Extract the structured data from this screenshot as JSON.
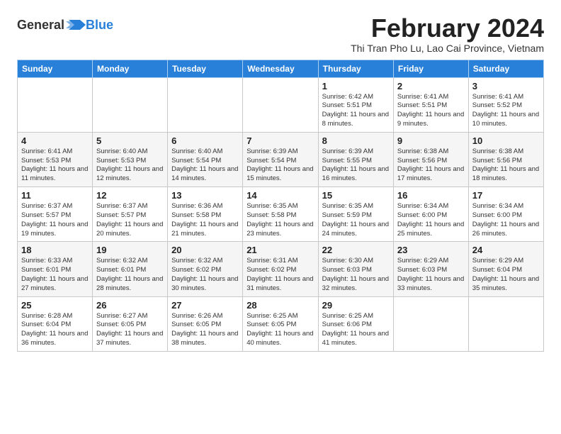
{
  "logo": {
    "general": "General",
    "blue": "Blue"
  },
  "header": {
    "month_year": "February 2024",
    "location": "Thi Tran Pho Lu, Lao Cai Province, Vietnam"
  },
  "weekdays": [
    "Sunday",
    "Monday",
    "Tuesday",
    "Wednesday",
    "Thursday",
    "Friday",
    "Saturday"
  ],
  "weeks": [
    [
      {
        "day": "",
        "info": ""
      },
      {
        "day": "",
        "info": ""
      },
      {
        "day": "",
        "info": ""
      },
      {
        "day": "",
        "info": ""
      },
      {
        "day": "1",
        "info": "Sunrise: 6:42 AM\nSunset: 5:51 PM\nDaylight: 11 hours and 8 minutes."
      },
      {
        "day": "2",
        "info": "Sunrise: 6:41 AM\nSunset: 5:51 PM\nDaylight: 11 hours and 9 minutes."
      },
      {
        "day": "3",
        "info": "Sunrise: 6:41 AM\nSunset: 5:52 PM\nDaylight: 11 hours and 10 minutes."
      }
    ],
    [
      {
        "day": "4",
        "info": "Sunrise: 6:41 AM\nSunset: 5:53 PM\nDaylight: 11 hours and 11 minutes."
      },
      {
        "day": "5",
        "info": "Sunrise: 6:40 AM\nSunset: 5:53 PM\nDaylight: 11 hours and 12 minutes."
      },
      {
        "day": "6",
        "info": "Sunrise: 6:40 AM\nSunset: 5:54 PM\nDaylight: 11 hours and 14 minutes."
      },
      {
        "day": "7",
        "info": "Sunrise: 6:39 AM\nSunset: 5:54 PM\nDaylight: 11 hours and 15 minutes."
      },
      {
        "day": "8",
        "info": "Sunrise: 6:39 AM\nSunset: 5:55 PM\nDaylight: 11 hours and 16 minutes."
      },
      {
        "day": "9",
        "info": "Sunrise: 6:38 AM\nSunset: 5:56 PM\nDaylight: 11 hours and 17 minutes."
      },
      {
        "day": "10",
        "info": "Sunrise: 6:38 AM\nSunset: 5:56 PM\nDaylight: 11 hours and 18 minutes."
      }
    ],
    [
      {
        "day": "11",
        "info": "Sunrise: 6:37 AM\nSunset: 5:57 PM\nDaylight: 11 hours and 19 minutes."
      },
      {
        "day": "12",
        "info": "Sunrise: 6:37 AM\nSunset: 5:57 PM\nDaylight: 11 hours and 20 minutes."
      },
      {
        "day": "13",
        "info": "Sunrise: 6:36 AM\nSunset: 5:58 PM\nDaylight: 11 hours and 21 minutes."
      },
      {
        "day": "14",
        "info": "Sunrise: 6:35 AM\nSunset: 5:58 PM\nDaylight: 11 hours and 23 minutes."
      },
      {
        "day": "15",
        "info": "Sunrise: 6:35 AM\nSunset: 5:59 PM\nDaylight: 11 hours and 24 minutes."
      },
      {
        "day": "16",
        "info": "Sunrise: 6:34 AM\nSunset: 6:00 PM\nDaylight: 11 hours and 25 minutes."
      },
      {
        "day": "17",
        "info": "Sunrise: 6:34 AM\nSunset: 6:00 PM\nDaylight: 11 hours and 26 minutes."
      }
    ],
    [
      {
        "day": "18",
        "info": "Sunrise: 6:33 AM\nSunset: 6:01 PM\nDaylight: 11 hours and 27 minutes."
      },
      {
        "day": "19",
        "info": "Sunrise: 6:32 AM\nSunset: 6:01 PM\nDaylight: 11 hours and 28 minutes."
      },
      {
        "day": "20",
        "info": "Sunrise: 6:32 AM\nSunset: 6:02 PM\nDaylight: 11 hours and 30 minutes."
      },
      {
        "day": "21",
        "info": "Sunrise: 6:31 AM\nSunset: 6:02 PM\nDaylight: 11 hours and 31 minutes."
      },
      {
        "day": "22",
        "info": "Sunrise: 6:30 AM\nSunset: 6:03 PM\nDaylight: 11 hours and 32 minutes."
      },
      {
        "day": "23",
        "info": "Sunrise: 6:29 AM\nSunset: 6:03 PM\nDaylight: 11 hours and 33 minutes."
      },
      {
        "day": "24",
        "info": "Sunrise: 6:29 AM\nSunset: 6:04 PM\nDaylight: 11 hours and 35 minutes."
      }
    ],
    [
      {
        "day": "25",
        "info": "Sunrise: 6:28 AM\nSunset: 6:04 PM\nDaylight: 11 hours and 36 minutes."
      },
      {
        "day": "26",
        "info": "Sunrise: 6:27 AM\nSunset: 6:05 PM\nDaylight: 11 hours and 37 minutes."
      },
      {
        "day": "27",
        "info": "Sunrise: 6:26 AM\nSunset: 6:05 PM\nDaylight: 11 hours and 38 minutes."
      },
      {
        "day": "28",
        "info": "Sunrise: 6:25 AM\nSunset: 6:05 PM\nDaylight: 11 hours and 40 minutes."
      },
      {
        "day": "29",
        "info": "Sunrise: 6:25 AM\nSunset: 6:06 PM\nDaylight: 11 hours and 41 minutes."
      },
      {
        "day": "",
        "info": ""
      },
      {
        "day": "",
        "info": ""
      }
    ]
  ]
}
